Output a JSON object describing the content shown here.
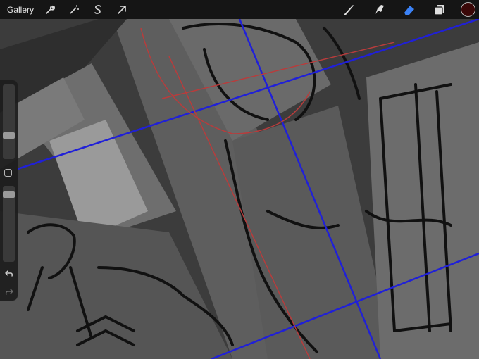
{
  "app": {
    "toolbar": {
      "gallery_label": "Gallery",
      "left_tools": [
        {
          "name": "actions-wrench-icon"
        },
        {
          "name": "adjustments-wand-icon"
        },
        {
          "name": "selection-s-icon"
        },
        {
          "name": "transform-arrow-icon"
        }
      ],
      "right_tools": [
        {
          "name": "brush-icon",
          "active": false
        },
        {
          "name": "smudge-icon",
          "active": false
        },
        {
          "name": "eraser-icon",
          "active": true
        },
        {
          "name": "layers-icon",
          "active": false
        }
      ],
      "current_color": "#3a0808",
      "active_tool_color": "#3b82f6"
    },
    "sidebar": {
      "brush_size_level": 0.3,
      "opacity_level": 0.15,
      "undo_icon": "undo-icon",
      "redo_icon": "redo-icon"
    }
  }
}
